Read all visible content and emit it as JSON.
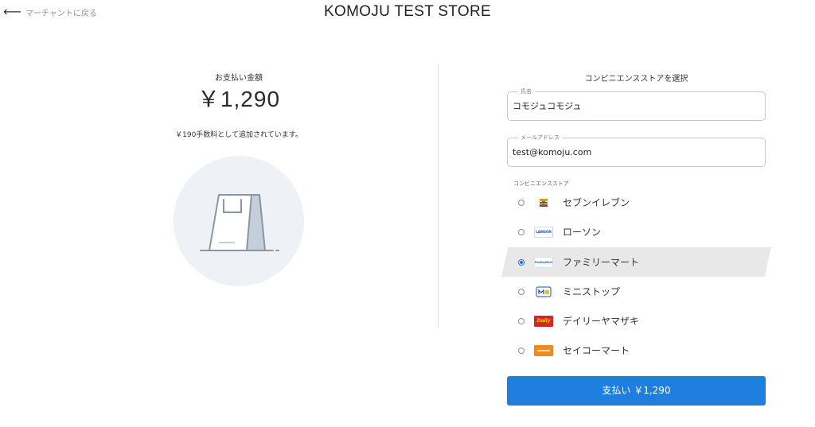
{
  "header": {
    "back_label": "マーチャントに戻る",
    "store_title": "KOMOJU TEST STORE"
  },
  "summary": {
    "amount_label": "お支払い金額",
    "amount": "￥1,290",
    "fee_note": "￥190手数料として追加されています。",
    "illustration_icon": "shopping-bag-icon"
  },
  "form": {
    "title": "コンビニエンスストアを選択",
    "name_label": "氏名",
    "name_value": "コモジュコモジュ",
    "email_label": "メールアドレス",
    "email_value": "test@komoju.com",
    "stores_label": "コンビニエンスストア",
    "stores": [
      {
        "name": "セブンイレブン",
        "logo": "seven-eleven-logo",
        "selected": false
      },
      {
        "name": "ローソン",
        "logo": "lawson-logo",
        "logo_text": "LAWSON",
        "selected": false
      },
      {
        "name": "ファミリーマート",
        "logo": "familymart-logo",
        "logo_text": "FamilyMart",
        "selected": true
      },
      {
        "name": "ミニストップ",
        "logo": "ministop-logo",
        "selected": false
      },
      {
        "name": "デイリーヤマザキ",
        "logo": "daily-yamazaki-logo",
        "logo_text": "Daily",
        "selected": false
      },
      {
        "name": "セイコーマート",
        "logo": "seicomart-logo",
        "selected": false
      }
    ],
    "pay_button": "支払い ￥1,290"
  },
  "colors": {
    "accent": "#1e7fe0",
    "selected_row": "#e8e8e8",
    "border": "#c4c8cd"
  }
}
